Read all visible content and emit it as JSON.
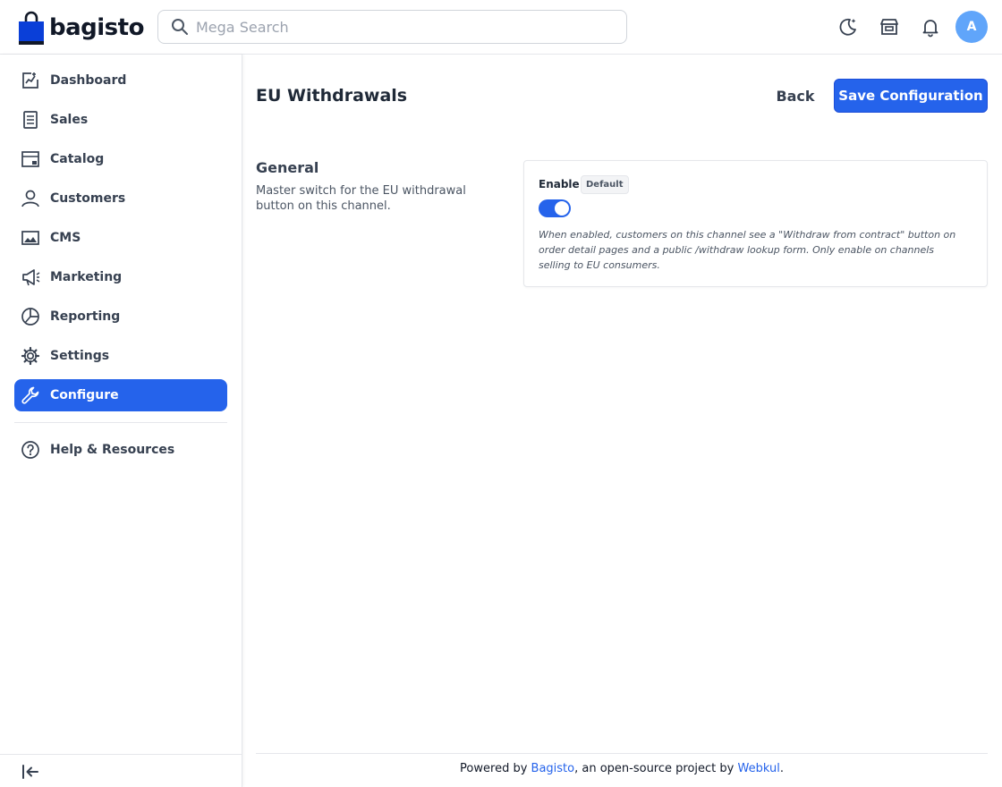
{
  "brand": {
    "name": "bagisto"
  },
  "search": {
    "placeholder": "Mega Search"
  },
  "header": {
    "icons": [
      "dark-mode-icon",
      "storefront-icon",
      "notification-bell-icon"
    ],
    "avatar_letter": "A",
    "avatar_color": "#60a5fa"
  },
  "sidebar": {
    "items": [
      {
        "label": "Dashboard",
        "icon": "dashboard-icon"
      },
      {
        "label": "Sales",
        "icon": "sales-icon"
      },
      {
        "label": "Catalog",
        "icon": "catalog-icon"
      },
      {
        "label": "Customers",
        "icon": "customers-icon"
      },
      {
        "label": "CMS",
        "icon": "cms-icon"
      },
      {
        "label": "Marketing",
        "icon": "marketing-icon"
      },
      {
        "label": "Reporting",
        "icon": "reporting-icon"
      },
      {
        "label": "Settings",
        "icon": "settings-icon"
      },
      {
        "label": "Configure",
        "icon": "configure-icon",
        "active": true
      }
    ],
    "help": {
      "label": "Help & Resources",
      "icon": "help-icon"
    },
    "active_color": "#2563eb"
  },
  "page": {
    "title": "EU Withdrawals",
    "back_label": "Back",
    "save_label": "Save Configuration"
  },
  "section": {
    "title": "General",
    "description": "Master switch for the EU withdrawal button on this channel."
  },
  "field": {
    "label": "Enable",
    "badge": "Default",
    "enabled": true,
    "help": "When enabled, customers on this channel see a \"Withdraw from contract\" button on order detail pages and a public /withdraw lookup form. Only enable on channels selling to EU consumers."
  },
  "footer": {
    "prefix": "Powered by ",
    "link1": "Bagisto",
    "middle": ", an open-source project by ",
    "link2": "Webkul",
    "suffix": "."
  }
}
